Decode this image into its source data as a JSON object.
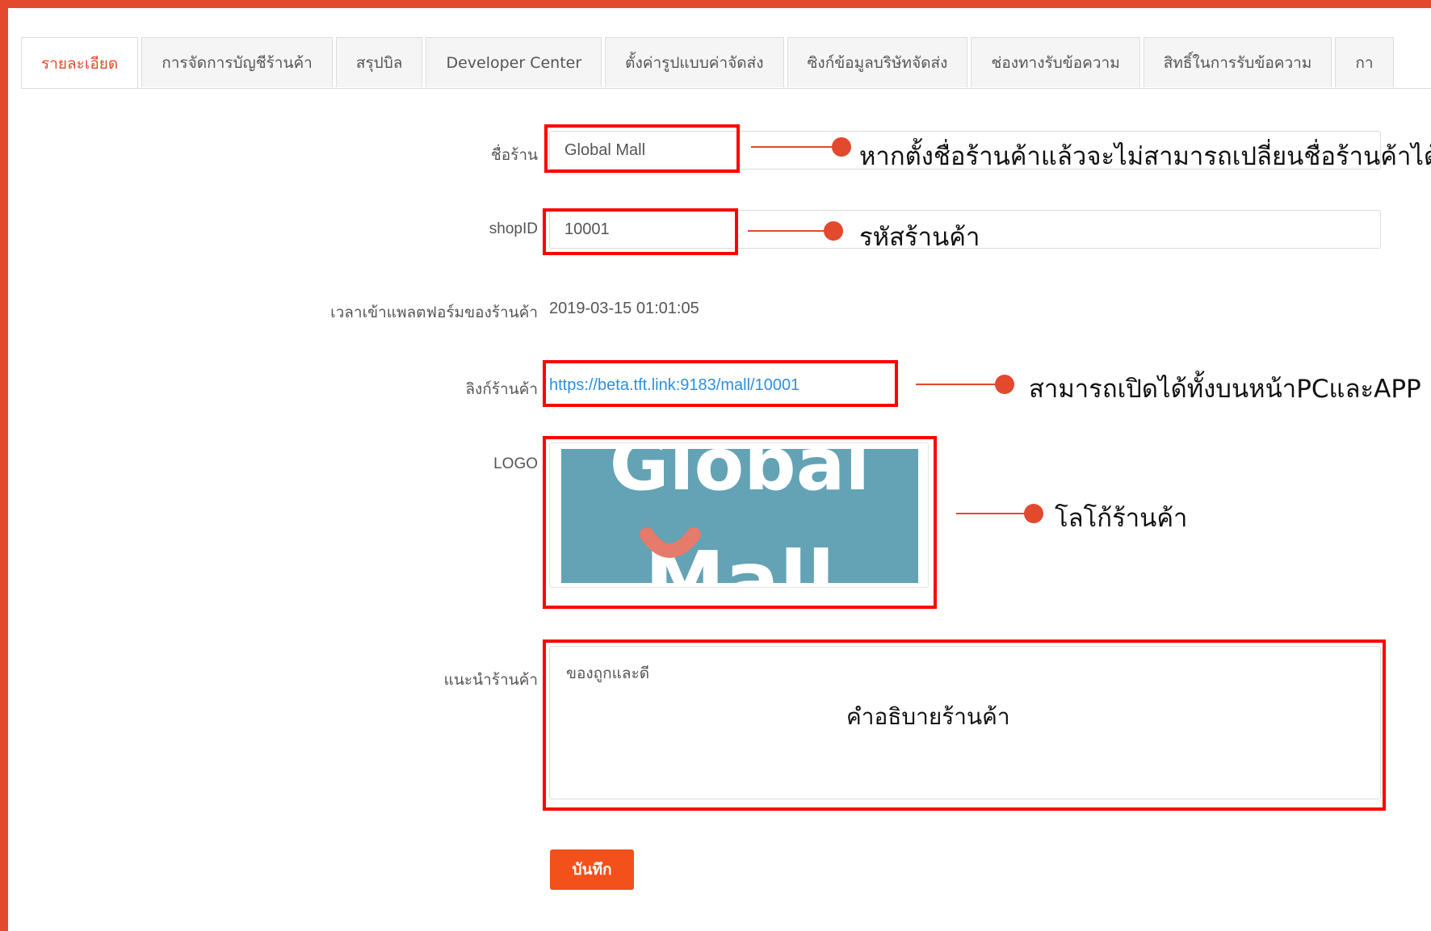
{
  "tabs": [
    {
      "label": "รายละเอียด",
      "active": true
    },
    {
      "label": "การจัดการบัญชีร้านค้า"
    },
    {
      "label": "สรุปบิล"
    },
    {
      "label": "Developer Center"
    },
    {
      "label": "ตั้งค่ารูปแบบค่าจัดส่ง"
    },
    {
      "label": "ซิงก์ข้อมูลบริษัทจัดส่ง"
    },
    {
      "label": "ช่องทางรับข้อความ"
    },
    {
      "label": "สิทธิ์ในการรับข้อความ"
    },
    {
      "label": "กา"
    }
  ],
  "form": {
    "shop_name_label": "ชื่อร้าน",
    "shop_name_value": "Global Mall",
    "shop_id_label": "shopID",
    "shop_id_value": "10001",
    "join_time_label": "เวลาเข้าแพลตฟอร์มของร้านค้า",
    "join_time_value": "2019-03-15 01:01:05",
    "shop_link_label": "ลิงก์ร้านค้า",
    "shop_link_value": "https://beta.tft.link:9183/mall/10001",
    "logo_label": "LOGO",
    "logo_text_line1": "Global",
    "logo_text_line2": "Mall",
    "intro_label": "แนะนำร้านค้า",
    "intro_value": "ของถูกและดี",
    "save_label": "บันทึก"
  },
  "annotations": {
    "shop_name_note": "หากตั้งชื่อร้านค้าแล้วจะไม่สามารถเปลี่ยนชื่อร้านค้าได้อีก",
    "shop_id_note": "รหัสร้านค้า",
    "shop_link_note": "สามารถเปิดได้ทั้งบนหน้าPCและAPP",
    "logo_note": "โลโก้ร้านค้า",
    "intro_note": "คำอธิบายร้านค้า"
  },
  "colors": {
    "accent": "#e2492d",
    "highlight_box": "#ff0000",
    "save_button": "#f2511b",
    "link": "#2d8fe0",
    "logo_bg": "#63a3b5"
  }
}
